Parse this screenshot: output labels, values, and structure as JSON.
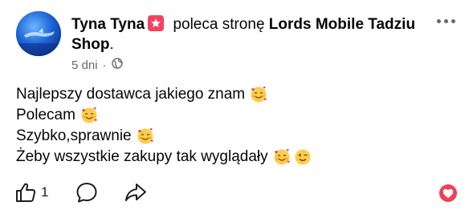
{
  "post": {
    "author": "Tyna Tyna",
    "action_text": "poleca stronę",
    "page_name": "Lords Mobile Tadziu Shop",
    "page_suffix": ".",
    "timestamp": "5 dni",
    "separator": "·",
    "audience_icon": "globe-icon",
    "badge_icon": "recommend-badge-icon",
    "lines": [
      {
        "text": "Najlepszy dostawca jakiego znam",
        "emojis": [
          "smiling-face-with-hearts-emoji"
        ]
      },
      {
        "text": "Polecam",
        "emojis": [
          "smiling-face-with-hearts-emoji"
        ]
      },
      {
        "text": "Szybko,sprawnie",
        "emojis": [
          "smiling-face-with-hearts-emoji"
        ]
      },
      {
        "text": "Żeby wszystkie zakupy tak wyglądały",
        "emojis": [
          "smiling-face-with-hearts-emoji",
          "winking-face-emoji"
        ]
      }
    ]
  },
  "actions": {
    "like_count": "1",
    "like_icon": "thumbs-up-icon",
    "comment_icon": "comment-icon",
    "share_icon": "share-icon",
    "reaction_icon": "love-reaction-icon"
  },
  "colors": {
    "badge": "#f3425f",
    "meta_text": "#65676b",
    "love_reaction": "#f33e58"
  }
}
